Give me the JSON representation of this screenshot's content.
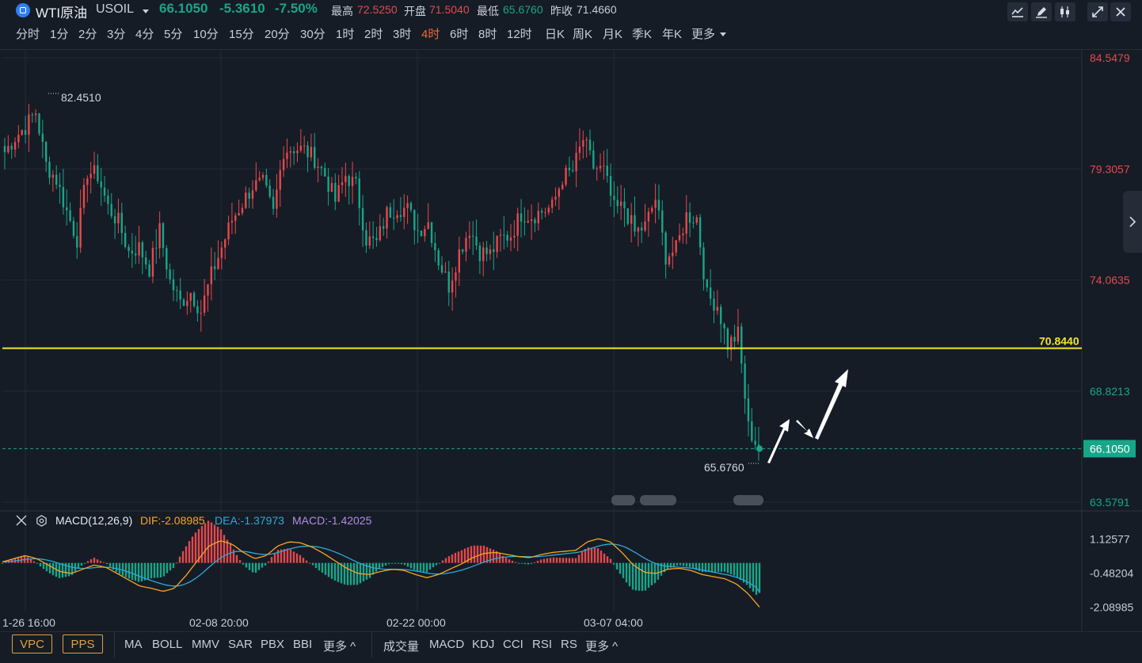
{
  "header": {
    "name": "WTI原油",
    "code": "USOIL",
    "price": "66.1050",
    "change": "-5.3610",
    "change_pct": "-7.50%",
    "high_label": "最高",
    "high": "72.5250",
    "open_label": "开盘",
    "open": "71.5040",
    "low_label": "最低",
    "low": "65.6760",
    "prev_label": "昨收",
    "prev": "71.4660"
  },
  "toolbar_icons": [
    "draw-line-icon",
    "pen-icon",
    "candle-type-icon",
    "expand-icon",
    "close-icon"
  ],
  "periods": [
    "分时",
    "1分",
    "2分",
    "3分",
    "4分",
    "5分",
    "10分",
    "15分",
    "20分",
    "30分",
    "1时",
    "2时",
    "3时",
    "4时",
    "6时",
    "8时",
    "12时",
    "日K",
    "周K",
    "月K",
    "季K",
    "年K",
    "更多"
  ],
  "active_period": "4时",
  "macd": {
    "title": "MACD(12,26,9)",
    "dif": "DIF:-2.08985",
    "dea": "DEA:-1.37973",
    "macd": "MACD:-1.42025"
  },
  "bottom": {
    "boxed": [
      "VPC",
      "PPS"
    ],
    "overlays": [
      "MA",
      "BOLL",
      "MMV",
      "SAR",
      "PBX",
      "BBI",
      "更多 ^"
    ],
    "indicators": [
      "成交量",
      "MACD",
      "KDJ",
      "CCI",
      "RSI",
      "RS",
      "更多 ^"
    ]
  },
  "colors": {
    "up": "#e5484d",
    "down": "#17a689",
    "level": "#f2e52e",
    "dif": "#f5a623",
    "dea": "#2fa8d8",
    "macd": "#b28be6",
    "active": "#f06a3a"
  },
  "chart_data": {
    "type": "candlestick",
    "price_axis_labels": [
      "84.5479",
      "79.3057",
      "74.0635",
      "68.8213",
      "63.5791"
    ],
    "ylim": [
      63.5791,
      84.5479
    ],
    "time_labels": [
      "1-26 16:00",
      "02-08 20:00",
      "02-22 00:00",
      "03-07 04:00"
    ],
    "max_marker": "82.4510",
    "min_marker": "65.6760",
    "horizontal_level": {
      "label": "70.8440",
      "value": 70.844
    },
    "last_price": {
      "label": "66.1050",
      "value": 66.105
    },
    "close_path": [
      80.1,
      80.8,
      81.3,
      82.0,
      79.5,
      78.8,
      77.3,
      76.0,
      79.2,
      79.0,
      77.5,
      76.8,
      75.4,
      75.6,
      74.6,
      76.4,
      74.0,
      73.0,
      73.5,
      72.6,
      74.3,
      75.6,
      76.9,
      77.7,
      78.5,
      78.6,
      77.2,
      80.2,
      80.3,
      80.2,
      79.8,
      79.0,
      77.8,
      79.0,
      78.5,
      76.0,
      75.8,
      77.2,
      77.5,
      77.4,
      76.4,
      76.8,
      75.0,
      73.8,
      75.4,
      76.5,
      75.4,
      75.3,
      76.0,
      76.2,
      77.2,
      77.1,
      77.3,
      77.5,
      78.9,
      79.2,
      80.7,
      79.4,
      79.2,
      77.4,
      77.5,
      76.3,
      76.6,
      77.9,
      75.2,
      75.5,
      77.1,
      77.0,
      73.3,
      72.9,
      71.0,
      71.5,
      67.1,
      66.105
    ],
    "macd_axis_labels": [
      "1.12577",
      "-0.48204",
      "-2.08985"
    ],
    "macd_ylim": [
      -2.3,
      1.45
    ],
    "dif_path": [
      0.05,
      0.2,
      0.35,
      0.2,
      -0.1,
      -0.4,
      -0.5,
      -0.3,
      -0.1,
      -0.2,
      -0.5,
      -0.8,
      -1.1,
      -1.2,
      -1.35,
      -1.2,
      -0.6,
      0.1,
      0.8,
      1.05,
      0.9,
      0.5,
      0.2,
      0.35,
      0.8,
      1.0,
      0.95,
      0.75,
      0.45,
      0.1,
      -0.25,
      -0.5,
      -0.55,
      -0.4,
      -0.3,
      -0.35,
      -0.55,
      -0.7,
      -0.55,
      -0.3,
      -0.05,
      0.25,
      0.45,
      0.5,
      0.4,
      0.3,
      0.25,
      0.4,
      0.5,
      0.55,
      0.6,
      1.0,
      1.15,
      1.0,
      0.5,
      -0.1,
      -0.45,
      -0.5,
      -0.3,
      -0.25,
      -0.35,
      -0.55,
      -0.65,
      -0.75,
      -1.0,
      -1.45,
      -2.09
    ]
  }
}
